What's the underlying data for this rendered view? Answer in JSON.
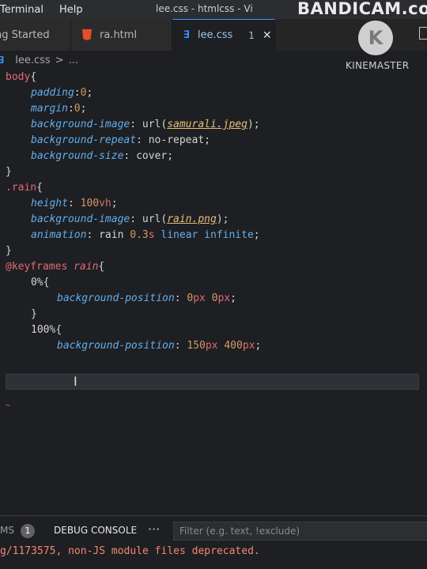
{
  "menubar": {
    "items": [
      "Terminal",
      "Help"
    ],
    "window_title": "lee.css - htmlcss - Vi",
    "watermark": "BANDICAM.co"
  },
  "overlay": {
    "kinemaster_logo_letter": "K",
    "kinemaster_text": "KINEMASTER"
  },
  "tabs": [
    {
      "label": "ng Started",
      "icon": "none"
    },
    {
      "label": "ra.html",
      "icon": "html-file-icon"
    },
    {
      "label": "lee.css",
      "icon": "css-file-icon",
      "badge": "1",
      "close": "✕",
      "active": true
    }
  ],
  "breadcrumb": {
    "file": "lee.css",
    "sep": ">",
    "more": "..."
  },
  "code": {
    "l1": {
      "sel": "body",
      "b": "{"
    },
    "l2": {
      "p": "padding",
      "c": ":",
      "n": "0",
      "e": ";"
    },
    "l3": {
      "p": "margin",
      "c": ":",
      "n": "0",
      "e": ";"
    },
    "l4": {
      "p": "background-image",
      "c": ": ",
      "f": "url(",
      "s": "samurali.jpeg",
      "e": ");"
    },
    "l5": {
      "p": "background-repeat",
      "c": ": ",
      "v": "no-repeat",
      "e": ";"
    },
    "l6": {
      "p": "background-size",
      "c": ": ",
      "v": "cover",
      "e": ";"
    },
    "l7": {
      "b": "}"
    },
    "l8": {
      "sel": ".rain",
      "b": "{"
    },
    "l9": {
      "p": "height",
      "c": ": ",
      "n": "100",
      "u": "vh",
      "e": ";"
    },
    "l10": {
      "p": "background-image",
      "c": ": ",
      "f": "url(",
      "s": "rain.png",
      "e": ");"
    },
    "l11": {
      "p": "animation",
      "c": ": ",
      "v1": "rain ",
      "n": "0.3",
      "u": "s",
      "v2": " linear infinite",
      "e": ";"
    },
    "l12": {
      "b": "}"
    },
    "l13": {
      "at": "@keyframes",
      "name": " rain",
      "b": "{"
    },
    "l14": {
      "n": "0",
      "u": "%",
      "b": "{"
    },
    "l15": {
      "p": "background-position",
      "c": ": ",
      "n1": "0",
      "u1": "px",
      "n2": " 0",
      "u2": "px",
      "e": ";"
    },
    "l16": {
      "b": "}"
    },
    "l17": {
      "n": "100",
      "u": "%",
      "b": "{"
    },
    "l18": {
      "p": "background-position",
      "c": ": ",
      "n1": "150",
      "u1": "px",
      "n2": " 400",
      "u2": "px",
      "e": ";"
    },
    "squiggle": "~"
  },
  "panel": {
    "problems_partial": "MS",
    "problems_count": "1",
    "debug_console": "DEBUG CONSOLE",
    "more": "···",
    "filter_placeholder": "Filter (e.g. text, !exclude)",
    "console_line": "g/1173575, non-JS module files deprecated."
  }
}
